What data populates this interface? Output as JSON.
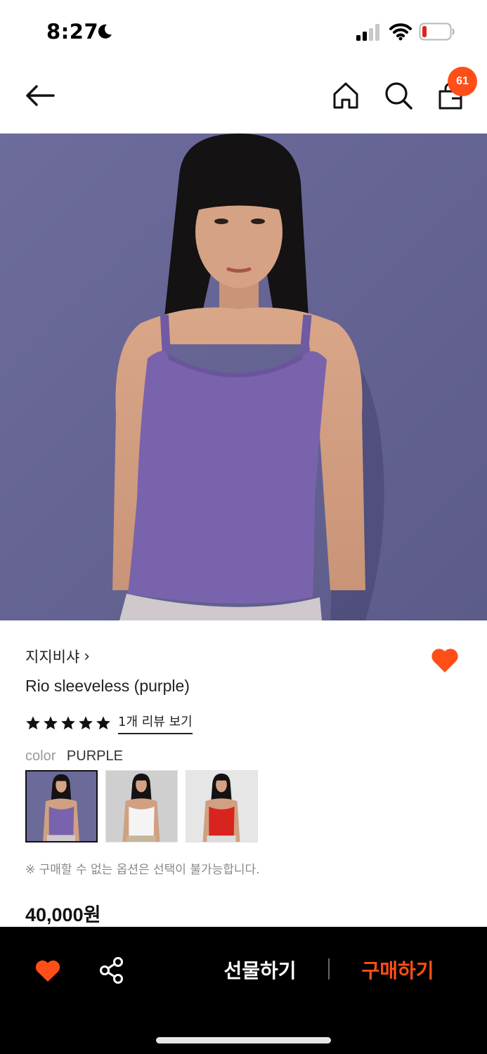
{
  "status_bar": {
    "time": "8:27",
    "icons": [
      "moon-icon",
      "signal-icon",
      "wifi-icon",
      "battery-icon"
    ]
  },
  "header": {
    "icons": [
      "back-arrow-icon",
      "home-icon",
      "search-icon",
      "shopping-bag-icon"
    ],
    "cart_count": "61"
  },
  "product": {
    "brand": "지지비샤",
    "brand_chevron": "›",
    "title": "Rio sleeveless (purple)",
    "rating": 5,
    "review_link": "1개 리뷰 보기",
    "color_label": "color",
    "color_value": "PURPLE",
    "swatches": [
      "purple",
      "white",
      "red"
    ],
    "selected_swatch": 0,
    "option_note": "※ 구매할 수 없는 옵션은 선택이 불가능합니다.",
    "price": "40,000원",
    "liked": true
  },
  "action_bar": {
    "gift_label": "선물하기",
    "buy_label": "구매하기"
  },
  "colors": {
    "accent": "#ff4e17",
    "action_bar_bg": "#000000",
    "background": "#ffffff",
    "photo_backdrop": "#6e6e9e",
    "top_purple": "#7a63ad",
    "top_white": "#f4f4f4",
    "top_red": "#d8231e"
  }
}
